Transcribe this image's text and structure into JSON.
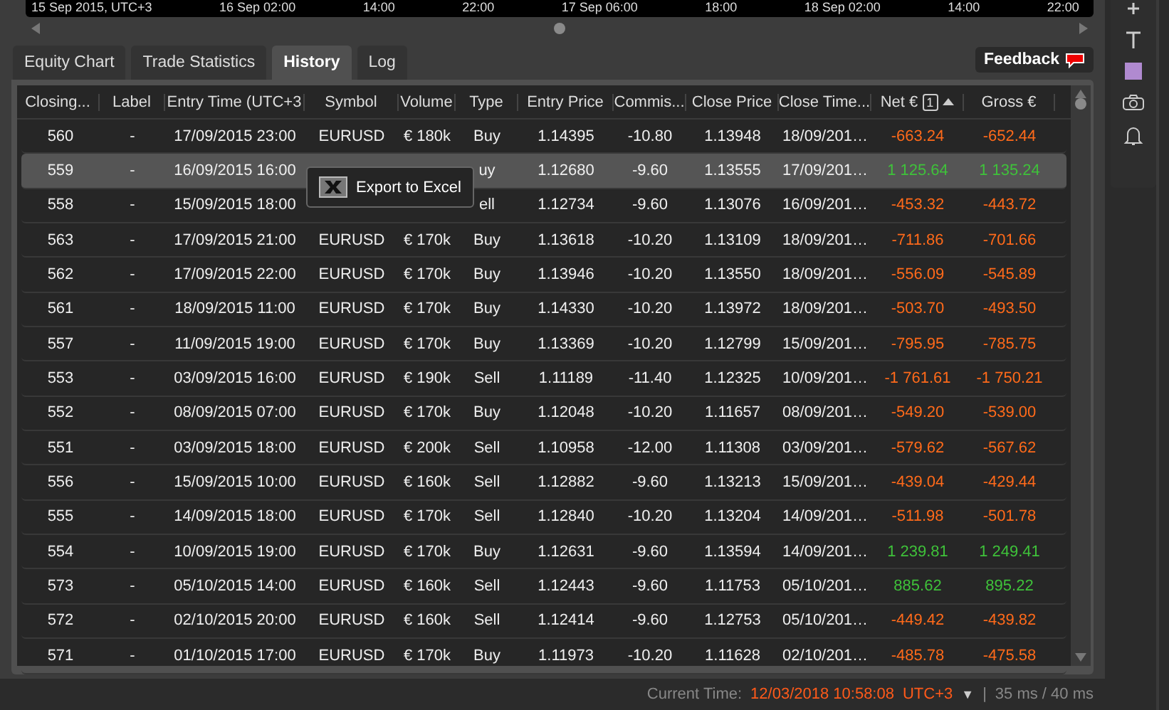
{
  "timeline": {
    "labels": [
      "15 Sep 2015, UTC+3",
      "16 Sep 02:00",
      "14:00",
      "22:00",
      "17 Sep 06:00",
      "18:00",
      "18 Sep 02:00",
      "14:00",
      "22:00"
    ]
  },
  "tabs": [
    {
      "label": "Equity Chart",
      "selected": false
    },
    {
      "label": "Trade Statistics",
      "selected": false
    },
    {
      "label": "History",
      "selected": true
    },
    {
      "label": "Log",
      "selected": false
    }
  ],
  "feedback_button": {
    "label": "Feedback"
  },
  "table": {
    "columns": [
      {
        "label": "Closing...",
        "sorted": false
      },
      {
        "label": "Label",
        "sorted": false
      },
      {
        "label": "Entry Time (UTC+3",
        "sorted": false
      },
      {
        "label": "Symbol",
        "sorted": false
      },
      {
        "label": "Volume",
        "sorted": false
      },
      {
        "label": "Type",
        "sorted": false
      },
      {
        "label": "Entry Price",
        "sorted": false
      },
      {
        "label": "Commis...",
        "sorted": false
      },
      {
        "label": "Close Price",
        "sorted": false
      },
      {
        "label": "Close Time...",
        "sorted": false
      },
      {
        "label": "Net €",
        "sorted": true,
        "sort_rank": "1"
      },
      {
        "label": "Gross €",
        "sorted": false
      }
    ],
    "rows": [
      {
        "selected": false,
        "profit": false,
        "cells": [
          "560",
          "-",
          "17/09/2015 23:00",
          "EURUSD",
          "€ 180k",
          "Buy",
          "1.14395",
          "-10.80",
          "1.13948",
          "18/09/201…",
          "-663.24",
          "-652.44"
        ]
      },
      {
        "selected": true,
        "profit": true,
        "cells": [
          "559",
          "-",
          "16/09/2015 16:00",
          "",
          "",
          "uy",
          "1.12680",
          "-9.60",
          "1.13555",
          "17/09/201…",
          "1 125.64",
          "1 135.24"
        ]
      },
      {
        "selected": false,
        "profit": false,
        "cells": [
          "558",
          "-",
          "15/09/2015 18:00",
          "",
          "",
          "ell",
          "1.12734",
          "-9.60",
          "1.13076",
          "16/09/201…",
          "-453.32",
          "-443.72"
        ]
      },
      {
        "selected": false,
        "profit": false,
        "cells": [
          "563",
          "-",
          "17/09/2015 21:00",
          "EURUSD",
          "€ 170k",
          "Buy",
          "1.13618",
          "-10.20",
          "1.13109",
          "18/09/201…",
          "-711.86",
          "-701.66"
        ]
      },
      {
        "selected": false,
        "profit": false,
        "cells": [
          "562",
          "-",
          "17/09/2015 22:00",
          "EURUSD",
          "€ 170k",
          "Buy",
          "1.13946",
          "-10.20",
          "1.13550",
          "18/09/201…",
          "-556.09",
          "-545.89"
        ]
      },
      {
        "selected": false,
        "profit": false,
        "cells": [
          "561",
          "-",
          "18/09/2015 11:00",
          "EURUSD",
          "€ 170k",
          "Buy",
          "1.14330",
          "-10.20",
          "1.13972",
          "18/09/201…",
          "-503.70",
          "-493.50"
        ]
      },
      {
        "selected": false,
        "profit": false,
        "cells": [
          "557",
          "-",
          "11/09/2015 19:00",
          "EURUSD",
          "€ 170k",
          "Buy",
          "1.13369",
          "-10.20",
          "1.12799",
          "15/09/201…",
          "-795.95",
          "-785.75"
        ]
      },
      {
        "selected": false,
        "profit": false,
        "cells": [
          "553",
          "-",
          "03/09/2015 16:00",
          "EURUSD",
          "€ 190k",
          "Sell",
          "1.11189",
          "-11.40",
          "1.12325",
          "10/09/201…",
          "-1 761.61",
          "-1 750.21"
        ]
      },
      {
        "selected": false,
        "profit": false,
        "cells": [
          "552",
          "-",
          "08/09/2015 07:00",
          "EURUSD",
          "€ 170k",
          "Buy",
          "1.12048",
          "-10.20",
          "1.11657",
          "08/09/201…",
          "-549.20",
          "-539.00"
        ]
      },
      {
        "selected": false,
        "profit": false,
        "cells": [
          "551",
          "-",
          "03/09/2015 18:00",
          "EURUSD",
          "€ 200k",
          "Sell",
          "1.10958",
          "-12.00",
          "1.11308",
          "03/09/201…",
          "-579.62",
          "-567.62"
        ]
      },
      {
        "selected": false,
        "profit": false,
        "cells": [
          "556",
          "-",
          "15/09/2015 10:00",
          "EURUSD",
          "€ 160k",
          "Sell",
          "1.12882",
          "-9.60",
          "1.13213",
          "15/09/201…",
          "-439.04",
          "-429.44"
        ]
      },
      {
        "selected": false,
        "profit": false,
        "cells": [
          "555",
          "-",
          "14/09/2015 18:00",
          "EURUSD",
          "€ 170k",
          "Sell",
          "1.12840",
          "-10.20",
          "1.13204",
          "14/09/201…",
          "-511.98",
          "-501.78"
        ]
      },
      {
        "selected": false,
        "profit": true,
        "cells": [
          "554",
          "-",
          "10/09/2015 19:00",
          "EURUSD",
          "€ 170k",
          "Buy",
          "1.12631",
          "-9.60",
          "1.13594",
          "14/09/201…",
          "1 239.81",
          "1 249.41"
        ]
      },
      {
        "selected": false,
        "profit": true,
        "cells": [
          "573",
          "-",
          "05/10/2015 14:00",
          "EURUSD",
          "€ 160k",
          "Sell",
          "1.12443",
          "-9.60",
          "1.11753",
          "05/10/201…",
          "885.62",
          "895.22"
        ]
      },
      {
        "selected": false,
        "profit": false,
        "cells": [
          "572",
          "-",
          "02/10/2015 20:00",
          "EURUSD",
          "€ 160k",
          "Sell",
          "1.12414",
          "-9.60",
          "1.12753",
          "05/10/201…",
          "-449.42",
          "-439.82"
        ]
      },
      {
        "selected": false,
        "profit": false,
        "cells": [
          "571",
          "-",
          "01/10/2015 17:00",
          "EURUSD",
          "€ 170k",
          "Buy",
          "1.11973",
          "-10.20",
          "1.11628",
          "02/10/201…",
          "-485.78",
          "-475.58"
        ]
      }
    ]
  },
  "context_menu": {
    "items": [
      "Export to Excel"
    ]
  },
  "status_bar": {
    "label": "Current Time:",
    "time": "12/03/2018 10:58:08",
    "timezone": "UTC+3",
    "caret": "▼",
    "separator": "|",
    "latency": "35 ms / 40 ms"
  }
}
